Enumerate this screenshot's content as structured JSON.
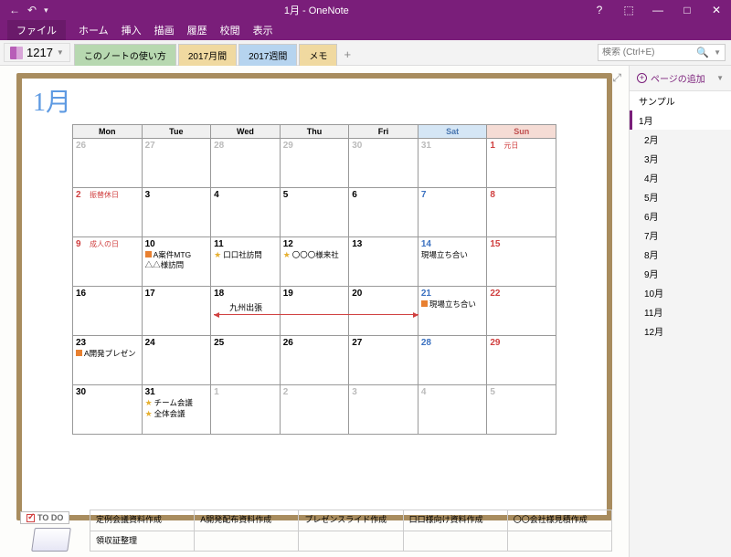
{
  "window": {
    "title": "1月 - OneNote"
  },
  "ribbon": {
    "file": "ファイル",
    "home": "ホーム",
    "insert": "挿入",
    "draw": "描画",
    "history": "履歴",
    "review": "校閲",
    "view": "表示"
  },
  "notebook": {
    "name": "1217"
  },
  "tabs": [
    "このノートの使い方",
    "2017月間",
    "2017週間",
    "メモ"
  ],
  "search": {
    "placeholder": "検索 (Ctrl+E)"
  },
  "addPage": "ページの追加",
  "pages": {
    "header": "サンプル",
    "items": [
      "1月",
      "2月",
      "3月",
      "4月",
      "5月",
      "6月",
      "7月",
      "8月",
      "9月",
      "10月",
      "11月",
      "12月"
    ],
    "selected": 0
  },
  "calendar": {
    "title": "1月",
    "dow": [
      "Mon",
      "Tue",
      "Wed",
      "Thu",
      "Fri",
      "Sat",
      "Sun"
    ],
    "cells": [
      [
        {
          "n": "26",
          "g": 1
        },
        {
          "n": "27",
          "g": 1
        },
        {
          "n": "28",
          "g": 1
        },
        {
          "n": "29",
          "g": 1
        },
        {
          "n": "30",
          "g": 1
        },
        {
          "n": "31",
          "g": 1
        },
        {
          "n": "1",
          "sun": 1,
          "hol": "元日"
        }
      ],
      [
        {
          "n": "2",
          "sun": 1,
          "hol": "振替休日"
        },
        {
          "n": "3"
        },
        {
          "n": "4"
        },
        {
          "n": "5"
        },
        {
          "n": "6"
        },
        {
          "n": "7",
          "sat": 1
        },
        {
          "n": "8",
          "sun": 1
        }
      ],
      [
        {
          "n": "9",
          "sun": 1,
          "hol": "成人の日"
        },
        {
          "n": "10",
          "ev": [
            {
              "t": "sq",
              "x": "A案件MTG"
            },
            {
              "t": "",
              "x": "△△様訪問"
            }
          ]
        },
        {
          "n": "11",
          "ev": [
            {
              "t": "st",
              "x": "口口社訪問"
            }
          ]
        },
        {
          "n": "12",
          "ev": [
            {
              "t": "st",
              "x": "〇〇〇様来社"
            }
          ]
        },
        {
          "n": "13"
        },
        {
          "n": "14",
          "sat": 1,
          "ev": [
            {
              "t": "",
              "x": "現場立ち合い"
            }
          ]
        },
        {
          "n": "15",
          "sun": 1
        }
      ],
      [
        {
          "n": "16"
        },
        {
          "n": "17"
        },
        {
          "n": "18",
          "arrow": "九州出張"
        },
        {
          "n": "19"
        },
        {
          "n": "20"
        },
        {
          "n": "21",
          "sat": 1,
          "ev": [
            {
              "t": "sq",
              "x": "現場立ち合い"
            }
          ]
        },
        {
          "n": "22",
          "sun": 1
        }
      ],
      [
        {
          "n": "23",
          "ev": [
            {
              "t": "sq",
              "x": "A開発プレゼン"
            }
          ]
        },
        {
          "n": "24"
        },
        {
          "n": "25"
        },
        {
          "n": "26"
        },
        {
          "n": "27"
        },
        {
          "n": "28",
          "sat": 1
        },
        {
          "n": "29",
          "sun": 1
        }
      ],
      [
        {
          "n": "30"
        },
        {
          "n": "31",
          "ev": [
            {
              "t": "st",
              "x": "チーム会議"
            },
            {
              "t": "st",
              "x": "全体会議"
            }
          ]
        },
        {
          "n": "1",
          "g": 1
        },
        {
          "n": "2",
          "g": 1
        },
        {
          "n": "3",
          "g": 1
        },
        {
          "n": "4",
          "g": 1
        },
        {
          "n": "5",
          "g": 1
        }
      ]
    ]
  },
  "todo": {
    "label": "TO DO",
    "rows": [
      [
        "定例会議資料作成",
        "A開発配布資料作成",
        "プレゼンスライド作成",
        "口口様向け資料作成",
        "〇〇会社様見積作成"
      ],
      [
        "領収証整理",
        "",
        "",
        "",
        ""
      ]
    ]
  }
}
